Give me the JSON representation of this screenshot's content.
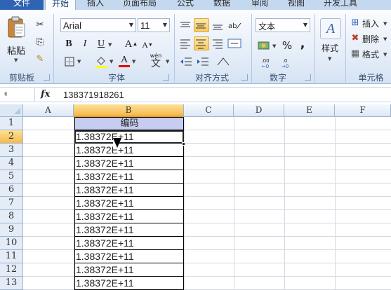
{
  "tabs": [
    {
      "label": "文件"
    },
    {
      "label": "开始"
    },
    {
      "label": "插入"
    },
    {
      "label": "页面布局"
    },
    {
      "label": "公式"
    },
    {
      "label": "数据"
    },
    {
      "label": "审阅"
    },
    {
      "label": "视图"
    },
    {
      "label": "开发工具"
    }
  ],
  "ribbon": {
    "clipboard": {
      "label": "剪贴板",
      "paste_label": "粘贴"
    },
    "font": {
      "label": "字体",
      "name": "Arial",
      "size": "11",
      "bold": "B",
      "italic": "I",
      "underline": "U",
      "grow": "A",
      "shrink": "A",
      "color_a": "A",
      "phonetic": "wén"
    },
    "alignment": {
      "label": "对齐方式"
    },
    "number": {
      "label": "数字",
      "format": "文本",
      "percent": "%",
      "comma": ",",
      "dec_inc": ".00",
      "dec_dec": ".0"
    },
    "styles": {
      "label": "样式"
    },
    "cells": {
      "label": "单元格",
      "insert": "插入",
      "delete": "删除",
      "format": "格式"
    }
  },
  "formula_bar": {
    "fx": "fx",
    "value": "138371918261"
  },
  "columns": [
    "A",
    "B",
    "C",
    "D",
    "E",
    "F"
  ],
  "rows": [
    "1",
    "2",
    "3",
    "4",
    "5",
    "6",
    "7",
    "8",
    "9",
    "10",
    "11",
    "12",
    "13"
  ],
  "cells": {
    "B1": "编码",
    "B_values": [
      "1.38372E+11",
      "1.38372E+11",
      "1.38372E+11",
      "1.38372E+11",
      "1.38372E+11",
      "1.38372E+11",
      "1.38372E+11",
      "1.38372E+11",
      "1.38372E+11",
      "1.38372E+11",
      "1.38372E+11",
      "1.38372E+11"
    ]
  },
  "colors": {
    "header_fill": "#c7cdf0",
    "selection": "#f6b94c",
    "ribbon": "#dde8f6"
  }
}
